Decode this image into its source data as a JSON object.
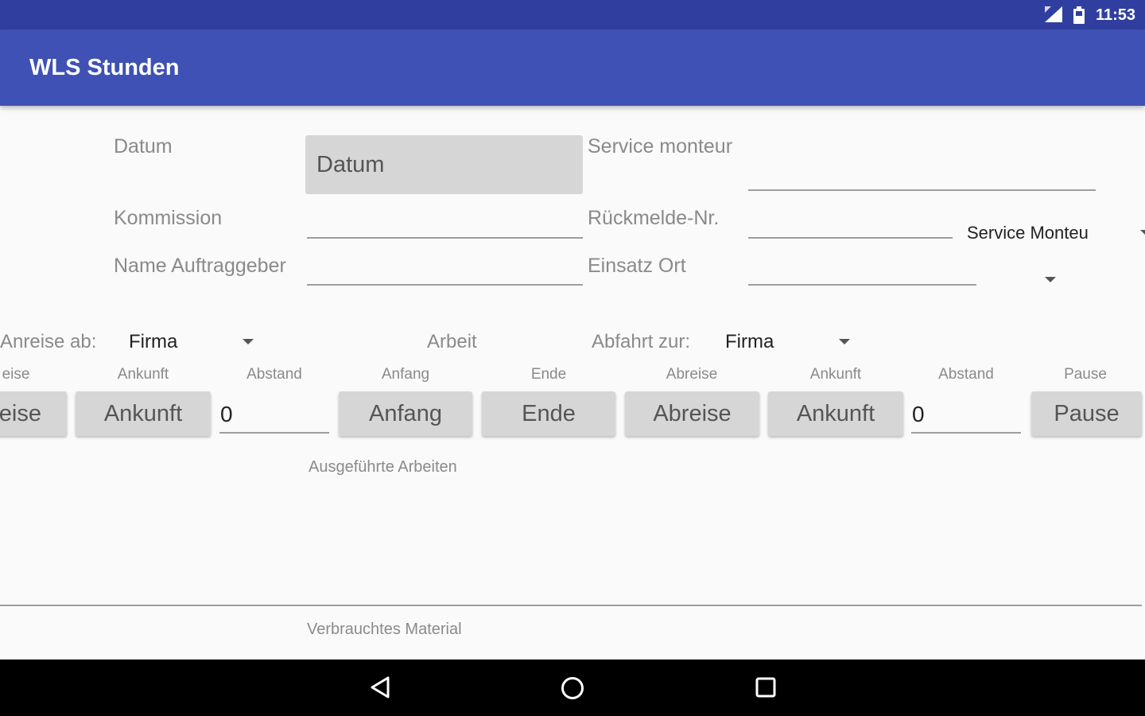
{
  "status_bar": {
    "time": "11:53"
  },
  "app_bar": {
    "title": "WLS Stunden"
  },
  "form": {
    "datum_label": "Datum",
    "datum_button": "Datum",
    "service_monteur_label": "Service monteur",
    "kommission_label": "Kommission",
    "rueckmelde_label": "Rückmelde-Nr.",
    "service_monteur_spinner": "Service Monteu",
    "name_auftraggeber_label": "Name Auftraggeber",
    "einsatz_ort_label": "Einsatz Ort"
  },
  "times": {
    "anreise_ab_label": "Anreise ab:",
    "anreise_ab_value": "Firma",
    "arbeit_label": "Arbeit",
    "abfahrt_zur_label": "Abfahrt zur:",
    "abfahrt_zur_value": "Firma",
    "headers": {
      "abreise1": "eise",
      "ankunft1": "Ankunft",
      "abstand1": "Abstand",
      "anfang": "Anfang",
      "ende": "Ende",
      "abreise2": "Abreise",
      "ankunft2": "Ankunft",
      "abstand2": "Abstand",
      "pause": "Pause"
    },
    "buttons": {
      "abreise1": "eise",
      "ankunft1": "Ankunft",
      "anfang": "Anfang",
      "ende": "Ende",
      "abreise2": "Abreise",
      "ankunft2": "Ankunft",
      "pause": "Pause"
    },
    "abstand1_value": "0",
    "abstand2_value": "0"
  },
  "sections": {
    "ausgefuehrte_arbeiten": "Ausgeführte Arbeiten",
    "verbrauchtes_material": "Verbrauchtes Material"
  }
}
